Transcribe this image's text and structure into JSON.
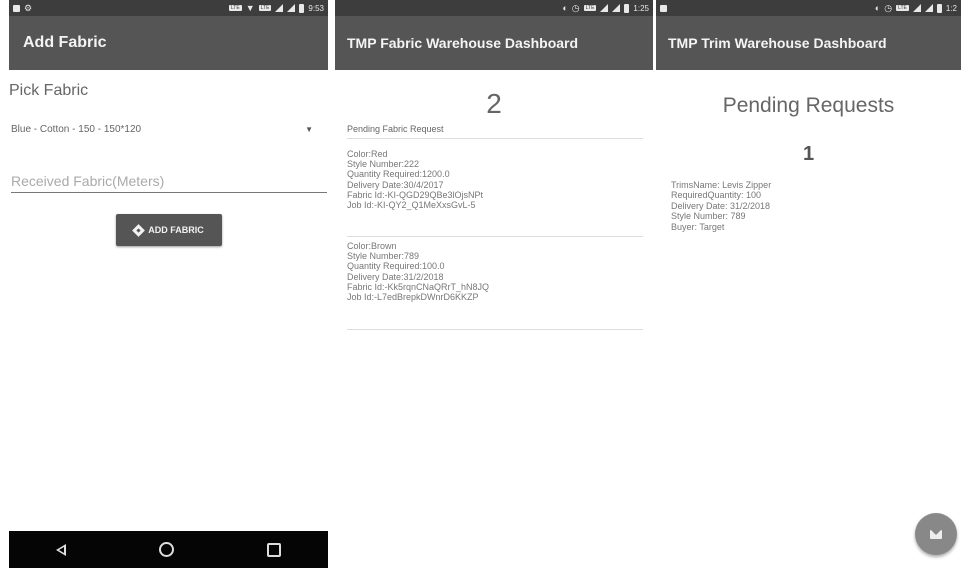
{
  "screen1": {
    "status": {
      "time": "9:53",
      "lte": "LTE"
    },
    "title": "Add Fabric",
    "pick_label": "Pick Fabric",
    "spinner_value": "Blue - Cotton - 150 - 150*120",
    "input_placeholder": "Received Fabric(Meters)",
    "button_label": "ADD FABRIC"
  },
  "screen2": {
    "status": {
      "time": "1:25"
    },
    "title": "TMP Fabric Warehouse Dashboard",
    "count": "2",
    "section_title": "Pending Fabric Request",
    "requests": [
      {
        "lines": [
          "Color:Red",
          "Style Number:222",
          "Quantity Required:1200.0",
          "Delivery Date:30/4/2017",
          "Fabric Id:-KI-QGD29QBe3lOjsNPt",
          "Job Id:-KI-QY2_Q1MeXxsGvL-5"
        ]
      },
      {
        "lines": [
          "Color:Brown",
          "Style Number:789",
          "Quantity Required:100.0",
          "Delivery Date:31/2/2018",
          "Fabric Id:-Kk5rqnCNaQRrT_hN8JQ",
          "Job Id:-L7edBrepkDWnrD6KKZP"
        ]
      }
    ]
  },
  "screen3": {
    "status": {
      "time": "1:2"
    },
    "title": "TMP Trim Warehouse Dashboard",
    "pending_title": "Pending Requests",
    "count": "1",
    "trim_lines": [
      "TrimsName: Levis Zipper",
      "RequiredQuantity: 100",
      "Delivery Date: 31/2/2018",
      "Style Number: 789",
      "Buyer: Target"
    ]
  },
  "icons": [
    "back-icon",
    "home-icon",
    "recents-icon",
    "email-icon",
    "add-diamond-icon",
    "dropdown-arrow-icon"
  ]
}
